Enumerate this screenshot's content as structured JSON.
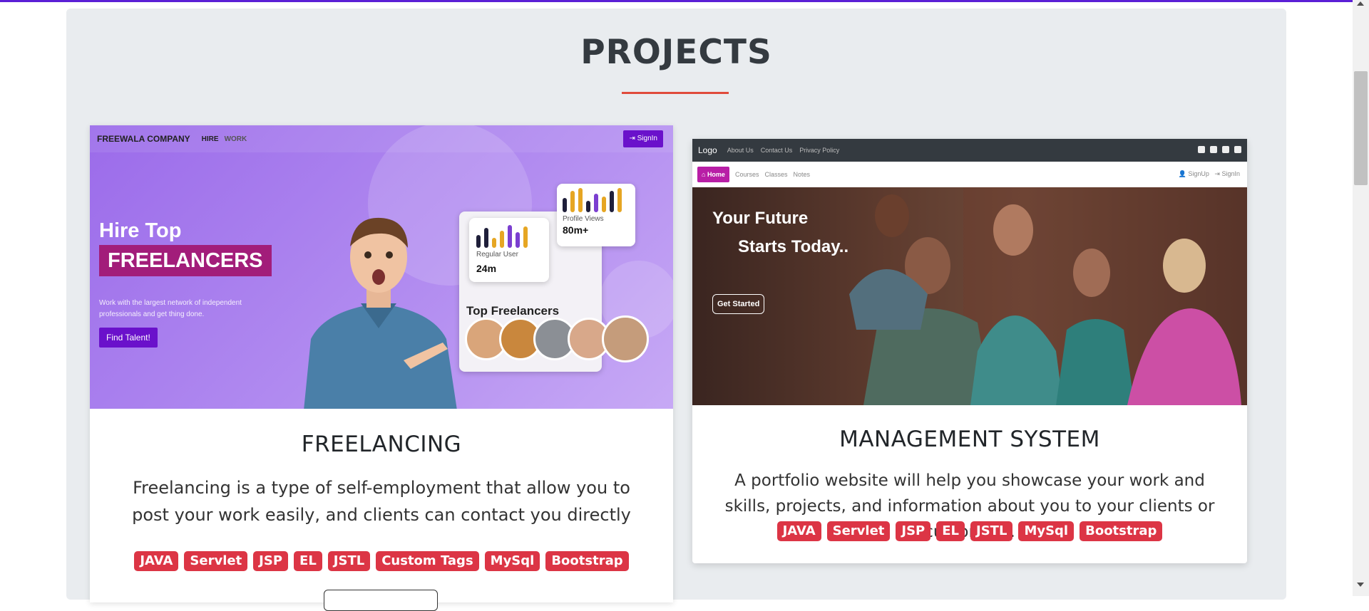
{
  "section": {
    "title": "PROJECTS"
  },
  "projects": [
    {
      "title": "FREELANCING",
      "description": "Freelancing is a type of self-employment that allow you to post your work easily, and clients can contact you directly",
      "tags": [
        "JAVA",
        "Servlet",
        "JSP",
        "EL",
        "JSTL",
        "Custom Tags",
        "MySql",
        "Bootstrap"
      ],
      "screenshot": {
        "brand": "FREEWALA COMPANY",
        "nav_hire": "HIRE",
        "nav_work": "WORK",
        "signin": "SignIn",
        "headline1": "Hire Top",
        "headline2": "FREELANCERS",
        "subtext": "Work with the largest network of independent professionals and get thing done.",
        "cta": "Find Talent!",
        "card_regular_label": "Regular User",
        "card_regular_value": "24m",
        "card_profile_label": "Profile Views",
        "card_profile_value": "80m+",
        "top_freelancers": "Top Freelancers"
      }
    },
    {
      "title": "MANAGEMENT SYSTEM",
      "description": "A portfolio website will help you showcase your work and skills, projects, and information about you to your clients or customers.",
      "tags": [
        "JAVA",
        "Servlet",
        "JSP",
        "EL",
        "JSTL",
        "MySql",
        "Bootstrap"
      ],
      "screenshot": {
        "logo": "Logo",
        "nav": [
          "About Us",
          "Contact Us",
          "Privacy Policy"
        ],
        "home": "Home",
        "subnav": [
          "Courses",
          "Classes",
          "Notes"
        ],
        "signup": "SignUp",
        "signin": "SignIn",
        "headline1": "Your Future",
        "headline2": "Starts Today..",
        "cta": "Get Started"
      }
    }
  ],
  "colors": {
    "accent": "#dc3545",
    "title_underline": "#e04b3c",
    "freelance_purple": "#6a11cb"
  }
}
